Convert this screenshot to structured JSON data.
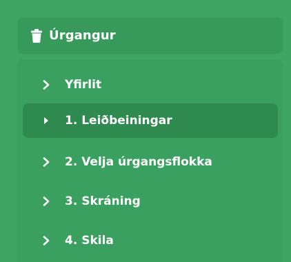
{
  "section": {
    "title": "Úrgangur",
    "icon": "trash-icon"
  },
  "menu": {
    "items": [
      {
        "label": "Yfirlit",
        "icon": "chevron-right-icon",
        "active": false
      },
      {
        "label": "1. Leiðbeiningar",
        "icon": "triangle-right-icon",
        "active": true
      },
      {
        "label": "2. Velja úrgangsflokka",
        "icon": "chevron-right-icon",
        "active": false
      },
      {
        "label": "3. Skráning",
        "icon": "chevron-right-icon",
        "active": false
      },
      {
        "label": "4. Skila",
        "icon": "chevron-right-icon",
        "active": false
      }
    ]
  },
  "colors": {
    "background": "#3ea565",
    "header_bg": "#379a5b",
    "submenu_bg": "#39a05f",
    "active_bg": "#2f8a50",
    "text": "#ffffff"
  }
}
